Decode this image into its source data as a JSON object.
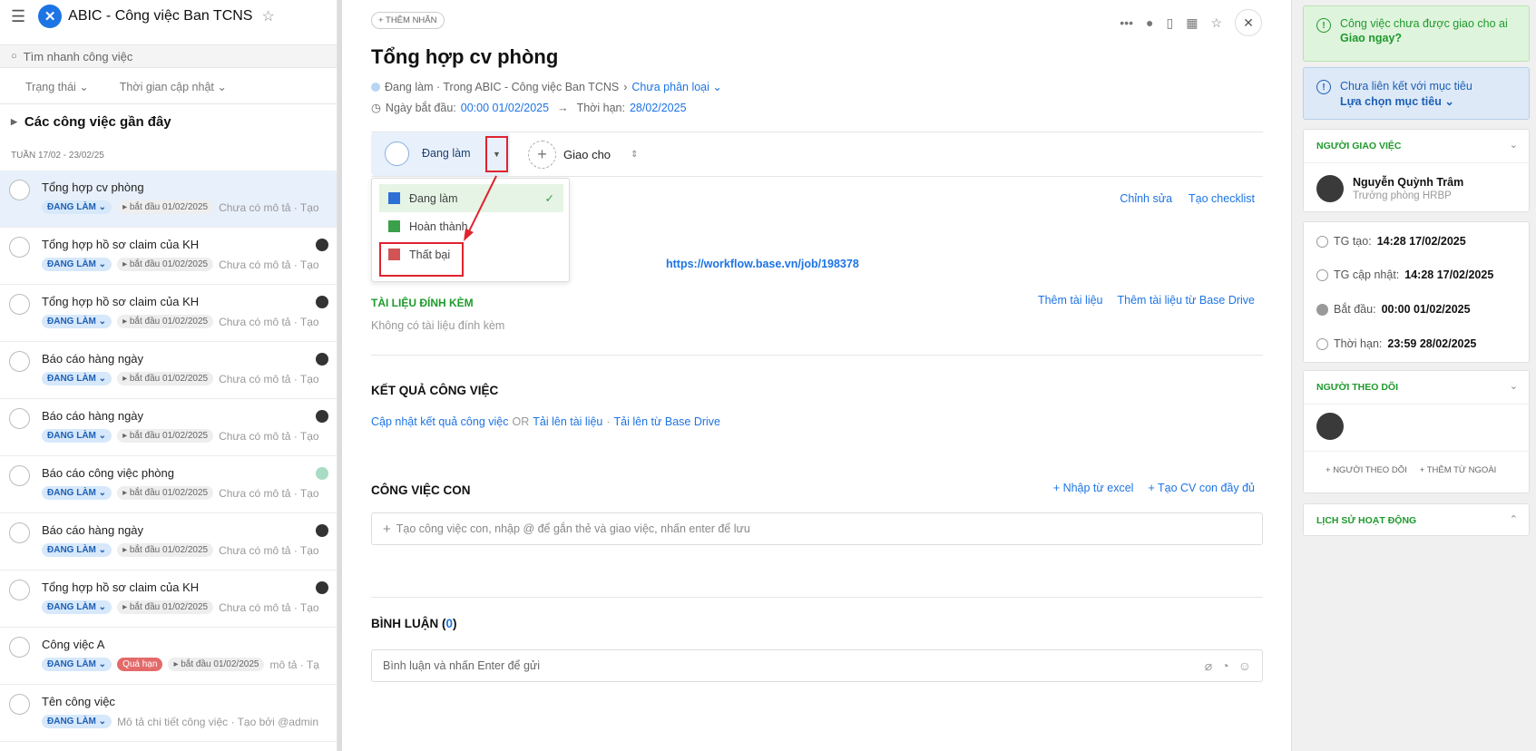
{
  "app": {
    "title": "ABIC - Công việc Ban TCNS"
  },
  "sidebar": {
    "search_placeholder": "Tìm nhanh công việc",
    "filter_status": "Trạng thái",
    "filter_time": "Thời gian cập nhật",
    "section_title": "Các công việc gần đây",
    "week_label": "TUẦN 17/02 - 23/02/25",
    "tasks": [
      {
        "name": "Tổng hợp cv phòng",
        "status": "ĐANG LÀM",
        "start": "bắt đầu 01/02/2025",
        "desc": "Chưa có mô tả · Tạo"
      },
      {
        "name": "Tổng hợp hồ sơ claim của KH",
        "status": "ĐANG LÀM",
        "start": "bắt đầu 01/02/2025",
        "desc": "Chưa có mô tả · Tạo"
      },
      {
        "name": "Tổng hợp hồ sơ claim của KH",
        "status": "ĐANG LÀM",
        "start": "bắt đầu 01/02/2025",
        "desc": "Chưa có mô tả · Tạo"
      },
      {
        "name": "Báo cáo hàng ngày",
        "status": "ĐANG LÀM",
        "start": "bắt đầu 01/02/2025",
        "desc": "Chưa có mô tả · Tạo"
      },
      {
        "name": "Báo cáo hàng ngày",
        "status": "ĐANG LÀM",
        "start": "bắt đầu 01/02/2025",
        "desc": "Chưa có mô tả · Tạo"
      },
      {
        "name": "Báo cáo công việc phòng",
        "status": "ĐANG LÀM",
        "start": "bắt đầu 01/02/2025",
        "desc": "Chưa có mô tả · Tạo"
      },
      {
        "name": "Báo cáo hàng ngày",
        "status": "ĐANG LÀM",
        "start": "bắt đầu 01/02/2025",
        "desc": "Chưa có mô tả · Tạo"
      },
      {
        "name": "Tổng hợp hồ sơ claim của KH",
        "status": "ĐANG LÀM",
        "start": "bắt đầu 01/02/2025",
        "desc": "Chưa có mô tả · Tạo"
      },
      {
        "name": "Công việc A",
        "status": "ĐANG LÀM",
        "overdue": "Quá hạn",
        "start": "bắt đầu 01/02/2025",
        "desc": "mô tả · Tạ"
      },
      {
        "name": "Tên công việc",
        "status": "ĐANG LÀM",
        "desc": "Mô tả chi tiết công việc · Tạo bởi @admin"
      }
    ]
  },
  "main": {
    "add_tag": "+ THÊM NHÃN",
    "title": "Tổng hợp cv phòng",
    "crumb_status": "Đang làm · Trong ABIC - Công việc Ban TCNS",
    "crumb_sep": "›",
    "crumb_category": "Chưa phân loại",
    "start_label": "Ngày bắt đầu:",
    "start_value": "00:00 01/02/2025",
    "due_label": "Thời hạn:",
    "due_value": "28/02/2025",
    "status_current": "Đang làm",
    "assign_label": "Giao cho",
    "status_menu": [
      {
        "label": "Đang làm",
        "color": "#2c6fd6"
      },
      {
        "label": "Hoàn thành",
        "color": "#3aa04a"
      },
      {
        "label": "Thất bại",
        "color": "#d35454"
      }
    ],
    "edit": "Chỉnh sửa",
    "create_checklist": "Tạo checklist",
    "link": "https://workflow.base.vn/job/198378",
    "attach_title": "TÀI LIỆU ĐÍNH KÈM",
    "add_doc": "Thêm tài liệu",
    "add_doc_drive": "Thêm tài liệu từ Base Drive",
    "no_attach": "Không có tài liệu đính kèm",
    "result_title": "KẾT QUẢ CÔNG VIỆC",
    "result_update": "Cập nhật kết quả công việc",
    "result_or": "OR",
    "result_upload": "Tải lên tài liệu",
    "result_dot": "·",
    "result_drive": "Tải lên từ Base Drive",
    "subtask_title": "CÔNG VIỆC CON",
    "import_excel": "Nhập từ excel",
    "create_full": "Tạo CV con đầy đủ",
    "subtask_placeholder": "Tạo công việc con, nhập @ để gắn thẻ và giao việc, nhấn enter để lưu",
    "comment_title": "BÌNH LUẬN (",
    "comment_count": "0",
    "comment_close": ")",
    "comment_placeholder": "Bình luận và nhấn Enter để gửi"
  },
  "right": {
    "alert_assign": "Công việc chưa được giao cho ai",
    "alert_assign_link": "Giao ngay?",
    "alert_goal": "Chưa liên kết với mục tiêu",
    "alert_goal_link": "Lựa chọn mục tiêu",
    "assigner_title": "NGƯỜI GIAO VIỆC",
    "assigner_name": "Nguyễn Quỳnh Trâm",
    "assigner_role": "Trưởng phòng HRBP",
    "created_label": "TG tạo:",
    "created_value": "14:28 17/02/2025",
    "updated_label": "TG cập nhật:",
    "updated_value": "14:28 17/02/2025",
    "start_label": "Bắt đầu:",
    "start_value": "00:00 01/02/2025",
    "due_label": "Thời hạn:",
    "due_value": "23:59 28/02/2025",
    "followers_title": "NGƯỜI THEO DÕI",
    "add_follower": "NGƯỜI THEO DÕI",
    "add_external": "THÊM TỪ NGOÀI",
    "history_title": "LỊCH SỬ HOẠT ĐỘNG"
  }
}
